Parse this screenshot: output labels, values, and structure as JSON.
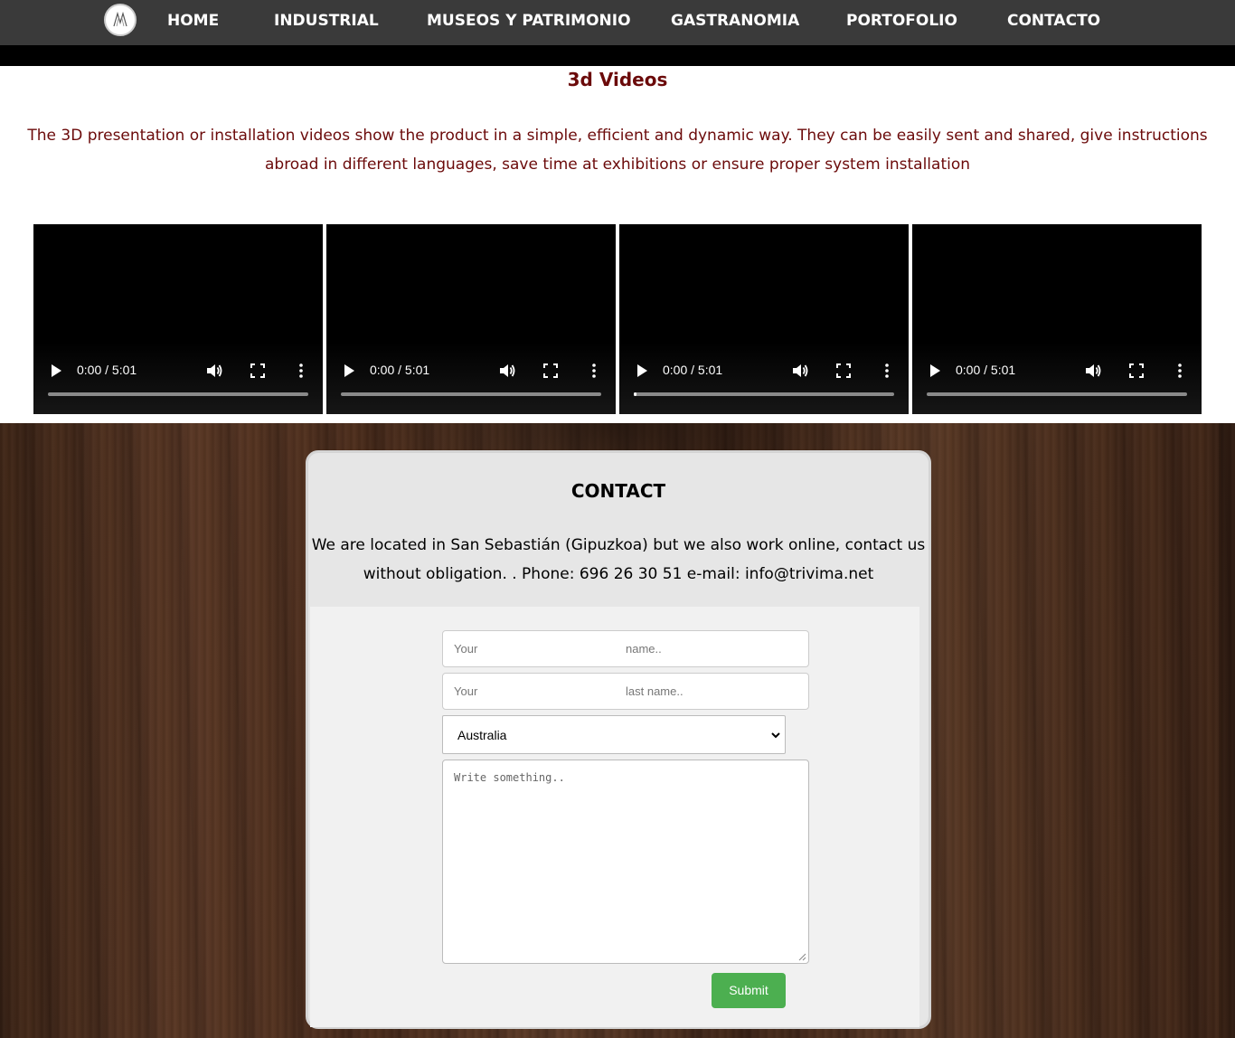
{
  "nav": {
    "items": [
      {
        "label": "HOME"
      },
      {
        "label": "INDUSTRIAL"
      },
      {
        "label": "MUSEOS Y PATRIMONIO"
      },
      {
        "label": "GASTRANOMIA"
      },
      {
        "label": "PORTOFOLIO"
      },
      {
        "label": "CONTACTO"
      }
    ]
  },
  "videos_section": {
    "title": "3d Videos",
    "description": "The 3D presentation or installation videos show the product in a simple, efficient and dynamic way. They can be easily sent and shared, give instructions abroad in different languages, save time at exhibitions or ensure proper system installation",
    "videos": [
      {
        "time": "0:00 / 5:01",
        "progress": 0
      },
      {
        "time": "0:00 / 5:01",
        "progress": 0
      },
      {
        "time": "0:00 / 5:01",
        "progress": 0.004
      },
      {
        "time": "0:00 / 5:01",
        "progress": 0
      }
    ]
  },
  "contact": {
    "title": "CONTACT",
    "text": "We are located in San Sebastián (Gipuzkoa) but we also work online, contact us without obligation. . Phone: 696 26 30 51 e-mail: info@trivima.net",
    "first_name_placeholder": [
      "Your",
      "name.."
    ],
    "last_name_placeholder": [
      "Your",
      "last name.."
    ],
    "country_selected": "Australia",
    "message_placeholder": "Write something..",
    "submit_label": "Submit"
  },
  "colors": {
    "nav_bg": "#3a3a3a",
    "heading_red": "#6b0a0a",
    "submit_green": "#4caf50",
    "card_bg": "#e6e6e6"
  }
}
